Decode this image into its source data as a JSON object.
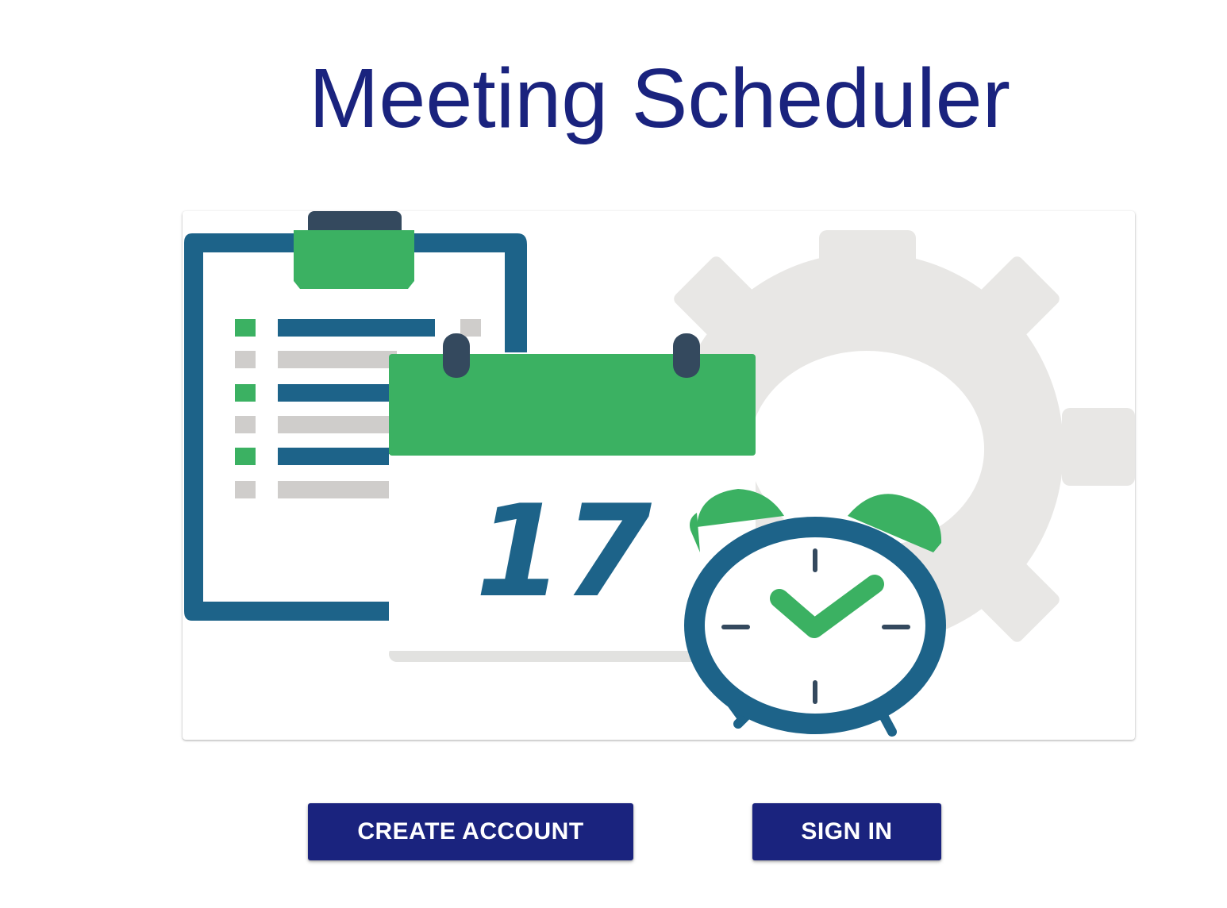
{
  "header": {
    "title": "Meeting Scheduler"
  },
  "hero": {
    "calendar_day": "17",
    "icons": [
      "clipboard-icon",
      "calendar-icon",
      "alarm-clock-icon",
      "gear-icon",
      "checkmark-icon"
    ]
  },
  "actions": {
    "create_account_label": "CREATE ACCOUNT",
    "sign_in_label": "SIGN IN"
  },
  "colors": {
    "title": "#1a237e",
    "button_bg": "#1a237e",
    "button_text": "#ffffff",
    "illustration_blue": "#1d6389",
    "illustration_green": "#3bb162",
    "illustration_dark": "#34495e",
    "illustration_gray": "#e8e7e5"
  }
}
